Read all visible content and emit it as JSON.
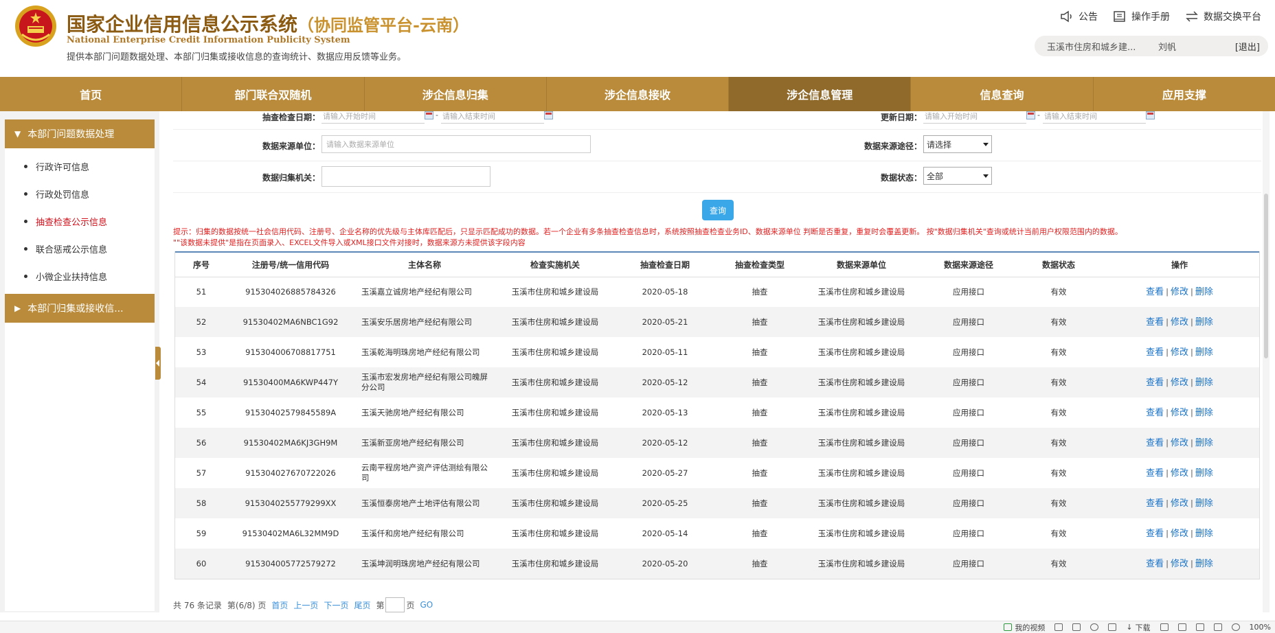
{
  "header": {
    "title_main": "国家企业信用信息公示系统",
    "title_sub": "（协同监管平台-云南）",
    "title_en": "National Enterprise Credit Information Publicity System",
    "description": "提供本部门问题数据处理、本部门归集或接收信息的查询统计、数据应用反馈等业务。",
    "links": {
      "announcement": "公告",
      "manual": "操作手册",
      "exchange": "数据交换平台"
    },
    "user": {
      "dept": "玉溪市住房和城乡建...",
      "name": "刘帆",
      "logout": "[退出]"
    }
  },
  "nav": {
    "items": [
      {
        "label": "首页"
      },
      {
        "label": "部门联合双随机"
      },
      {
        "label": "涉企信息归集"
      },
      {
        "label": "涉企信息接收"
      },
      {
        "label": "涉企信息管理"
      },
      {
        "label": "信息查询"
      },
      {
        "label": "应用支撑"
      }
    ],
    "active_index": 4
  },
  "sidebar": {
    "group1": "本部门问题数据处理",
    "items": [
      {
        "label": "行政许可信息"
      },
      {
        "label": "行政处罚信息"
      },
      {
        "label": "抽查检查公示信息"
      },
      {
        "label": "联合惩戒公示信息"
      },
      {
        "label": "小微企业扶持信息"
      }
    ],
    "active_index": 2,
    "group2": "本部门归集或接收信..."
  },
  "filter": {
    "check_date_label": "抽查检查日期：",
    "update_date_label": "更新日期：",
    "start_placeholder": "请输入开始时间",
    "end_placeholder": "请输入结束时间",
    "source_unit_label": "数据来源单位：",
    "source_unit_placeholder": "请输入数据来源单位",
    "source_route_label": "数据来源途径：",
    "source_route_value": "请选择",
    "collect_org_label": "数据归集机关：",
    "collect_org_value": "",
    "status_label": "数据状态：",
    "status_value": "全部",
    "query_button": "查询",
    "dash": "-"
  },
  "notice": {
    "line1": "提示：归集的数据按统一社会信用代码、注册号、企业名称的优先级与主体库匹配后，只显示匹配成功的数据。若一个企业有多条抽查检查信息时，系统按照抽查检查业务ID、数据来源单位 判断是否重复，重复时会覆盖更新。 按\"数据归集机关\"查询或统计当前用户权限范围内的数据。",
    "line2": "\"\"该数据未提供\"是指在页面录入、EXCEL文件导入或XML接口文件对接时，数据来源方未提供该字段内容"
  },
  "table": {
    "headers": [
      "序号",
      "注册号/统一信用代码",
      "主体名称",
      "检查实施机关",
      "抽查检查日期",
      "抽查检查类型",
      "数据来源单位",
      "数据来源途径",
      "数据状态",
      "操作"
    ],
    "rows": [
      {
        "no": "51",
        "code": "915304026885784326",
        "name": "玉溪嘉立诚房地产经纪有限公司",
        "org": "玉溪市住房和城乡建设局",
        "date": "2020-05-18",
        "type": "抽查",
        "unit": "玉溪市住房和城乡建设局",
        "route": "应用接口",
        "status": "有效"
      },
      {
        "no": "52",
        "code": "91530402MA6NBC1G92",
        "name": "玉溪安乐居房地产经纪有限公司",
        "org": "玉溪市住房和城乡建设局",
        "date": "2020-05-21",
        "type": "抽查",
        "unit": "玉溪市住房和城乡建设局",
        "route": "应用接口",
        "status": "有效"
      },
      {
        "no": "53",
        "code": "915304006708817751",
        "name": "玉溪乾海明珠房地产经纪有限公司",
        "org": "玉溪市住房和城乡建设局",
        "date": "2020-05-11",
        "type": "抽查",
        "unit": "玉溪市住房和城乡建设局",
        "route": "应用接口",
        "status": "有效"
      },
      {
        "no": "54",
        "code": "91530400MA6KWP447Y",
        "name": "玉溪市宏发房地产经纪有限公司魄屏分公司",
        "org": "玉溪市住房和城乡建设局",
        "date": "2020-05-12",
        "type": "抽查",
        "unit": "玉溪市住房和城乡建设局",
        "route": "应用接口",
        "status": "有效"
      },
      {
        "no": "55",
        "code": "91530402579845589A",
        "name": "玉溪天驰房地产经纪有限公司",
        "org": "玉溪市住房和城乡建设局",
        "date": "2020-05-13",
        "type": "抽查",
        "unit": "玉溪市住房和城乡建设局",
        "route": "应用接口",
        "status": "有效"
      },
      {
        "no": "56",
        "code": "91530402MA6KJ3GH9M",
        "name": "玉溪新亚房地产经纪有限公司",
        "org": "玉溪市住房和城乡建设局",
        "date": "2020-05-12",
        "type": "抽查",
        "unit": "玉溪市住房和城乡建设局",
        "route": "应用接口",
        "status": "有效"
      },
      {
        "no": "57",
        "code": "915304027670722026",
        "name": "云南平程房地产资产评估测绘有限公司",
        "org": "玉溪市住房和城乡建设局",
        "date": "2020-05-27",
        "type": "抽查",
        "unit": "玉溪市住房和城乡建设局",
        "route": "应用接口",
        "status": "有效"
      },
      {
        "no": "58",
        "code": "9153040255779299XX",
        "name": "玉溪恒泰房地产土地评估有限公司",
        "org": "玉溪市住房和城乡建设局",
        "date": "2020-05-25",
        "type": "抽查",
        "unit": "玉溪市住房和城乡建设局",
        "route": "应用接口",
        "status": "有效"
      },
      {
        "no": "59",
        "code": "91530402MA6L32MM9D",
        "name": "玉溪仟和房地产经纪有限公司",
        "org": "玉溪市住房和城乡建设局",
        "date": "2020-05-14",
        "type": "抽查",
        "unit": "玉溪市住房和城乡建设局",
        "route": "应用接口",
        "status": "有效"
      },
      {
        "no": "60",
        "code": "915304005772579272",
        "name": "玉溪坤润明珠房地产经纪有限公司",
        "org": "玉溪市住房和城乡建设局",
        "date": "2020-05-20",
        "type": "抽查",
        "unit": "玉溪市住房和城乡建设局",
        "route": "应用接口",
        "status": "有效"
      }
    ],
    "actions": {
      "view": "查看",
      "edit": "修改",
      "delete": "删除",
      "sep": "|"
    }
  },
  "pager": {
    "summary": "共 76 条记录",
    "page_info": "第(6/8) 页",
    "first": "首页",
    "prev": "上一页",
    "next": "下一页",
    "last": "尾页",
    "goto_prefix": "第",
    "goto_suffix": "页",
    "go": "GO"
  },
  "statusbar": {
    "video": "我的视频",
    "download": "下载",
    "zoom": "100%"
  },
  "colors": {
    "brand_gold": "#b98b3a",
    "nav_active": "#8f6a2b",
    "title_brown": "#8b5a13",
    "notice_red": "#e02020",
    "link_blue": "#1a73c9",
    "query_blue": "#3aa7e8"
  }
}
